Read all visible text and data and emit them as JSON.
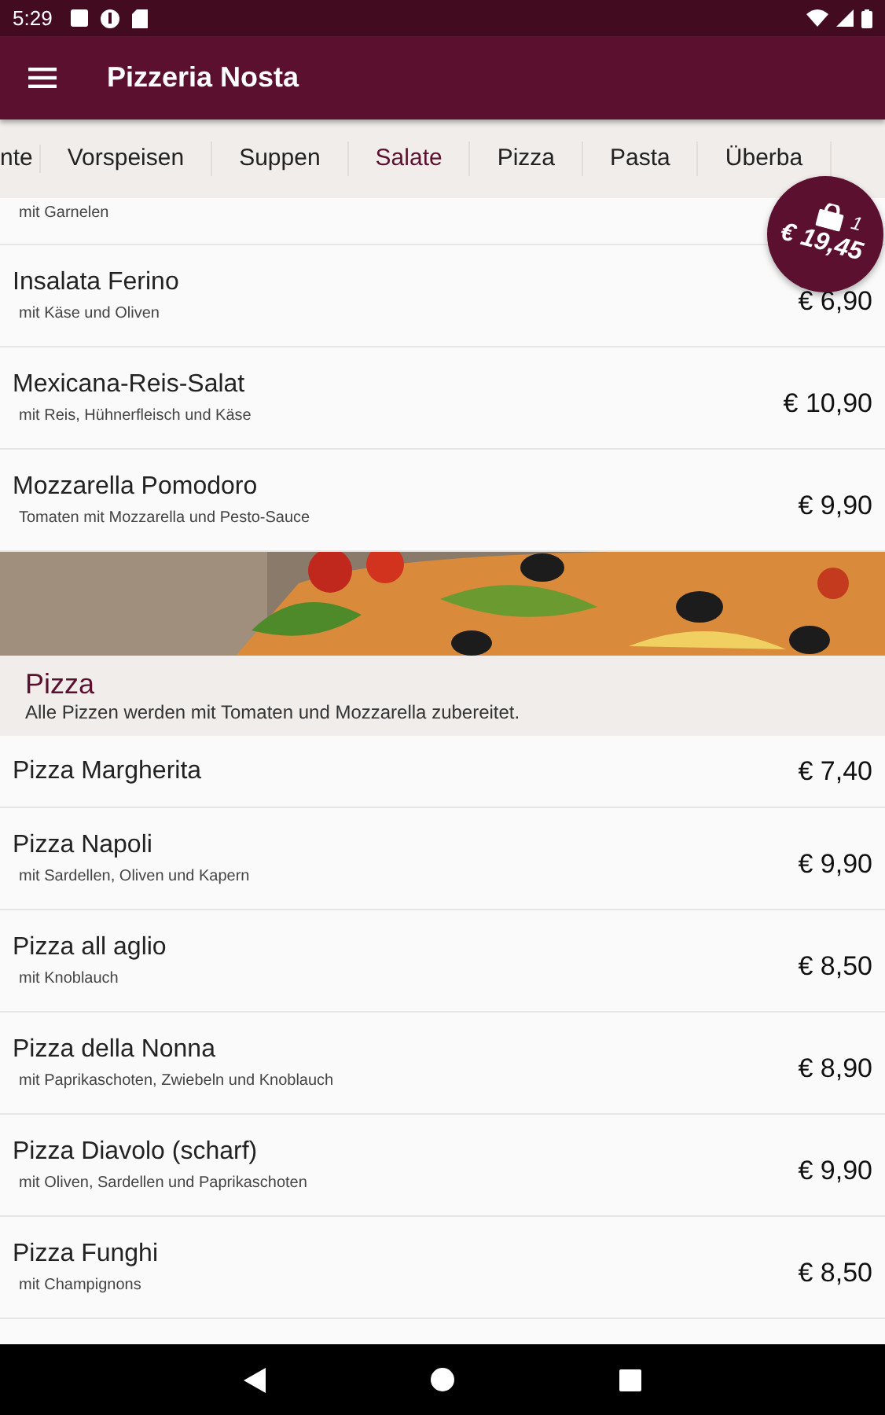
{
  "status_bar": {
    "time": "5:29"
  },
  "app_bar": {
    "title": "Pizzeria Nosta"
  },
  "tabs": [
    {
      "label": "nte",
      "selected": false
    },
    {
      "label": "Vorspeisen",
      "selected": false
    },
    {
      "label": "Suppen",
      "selected": false
    },
    {
      "label": "Salate",
      "selected": true
    },
    {
      "label": "Pizza",
      "selected": false
    },
    {
      "label": "Pasta",
      "selected": false
    },
    {
      "label": "Überba",
      "selected": false
    }
  ],
  "cart": {
    "count": "1",
    "total": "€ 19,45"
  },
  "menu": [
    {
      "kind": "item",
      "description": "mit Garnelen"
    },
    {
      "kind": "item",
      "name": "Insalata Ferino",
      "description": "mit Käse und Oliven",
      "price": "€ 6,90"
    },
    {
      "kind": "item",
      "name": "Mexicana-Reis-Salat",
      "description": "mit Reis, Hühnerfleisch und Käse",
      "price": "€ 10,90"
    },
    {
      "kind": "item",
      "name": "Mozzarella Pomodoro",
      "description": "Tomaten mit Mozzarella und Pesto-Sauce",
      "price": "€ 9,90"
    },
    {
      "kind": "banner"
    },
    {
      "kind": "section",
      "title": "Pizza",
      "description": "Alle Pizzen werden mit Tomaten und Mozzarella zubereitet."
    },
    {
      "kind": "item",
      "name": "Pizza Margherita",
      "price": "€ 7,40"
    },
    {
      "kind": "item",
      "name": "Pizza Napoli",
      "description": "mit Sardellen, Oliven und Kapern",
      "price": "€ 9,90"
    },
    {
      "kind": "item",
      "name": "Pizza all aglio",
      "description": "mit Knoblauch",
      "price": "€ 8,50"
    },
    {
      "kind": "item",
      "name": "Pizza della Nonna",
      "description": "mit Paprikaschoten, Zwiebeln und Knoblauch",
      "price": "€ 8,90"
    },
    {
      "kind": "item",
      "name": "Pizza Diavolo (scharf)",
      "description": "mit Oliven, Sardellen und Paprikaschoten",
      "price": "€ 9,90"
    },
    {
      "kind": "item",
      "name": "Pizza Funghi",
      "description": "mit Champignons",
      "price": "€ 8,50"
    }
  ]
}
